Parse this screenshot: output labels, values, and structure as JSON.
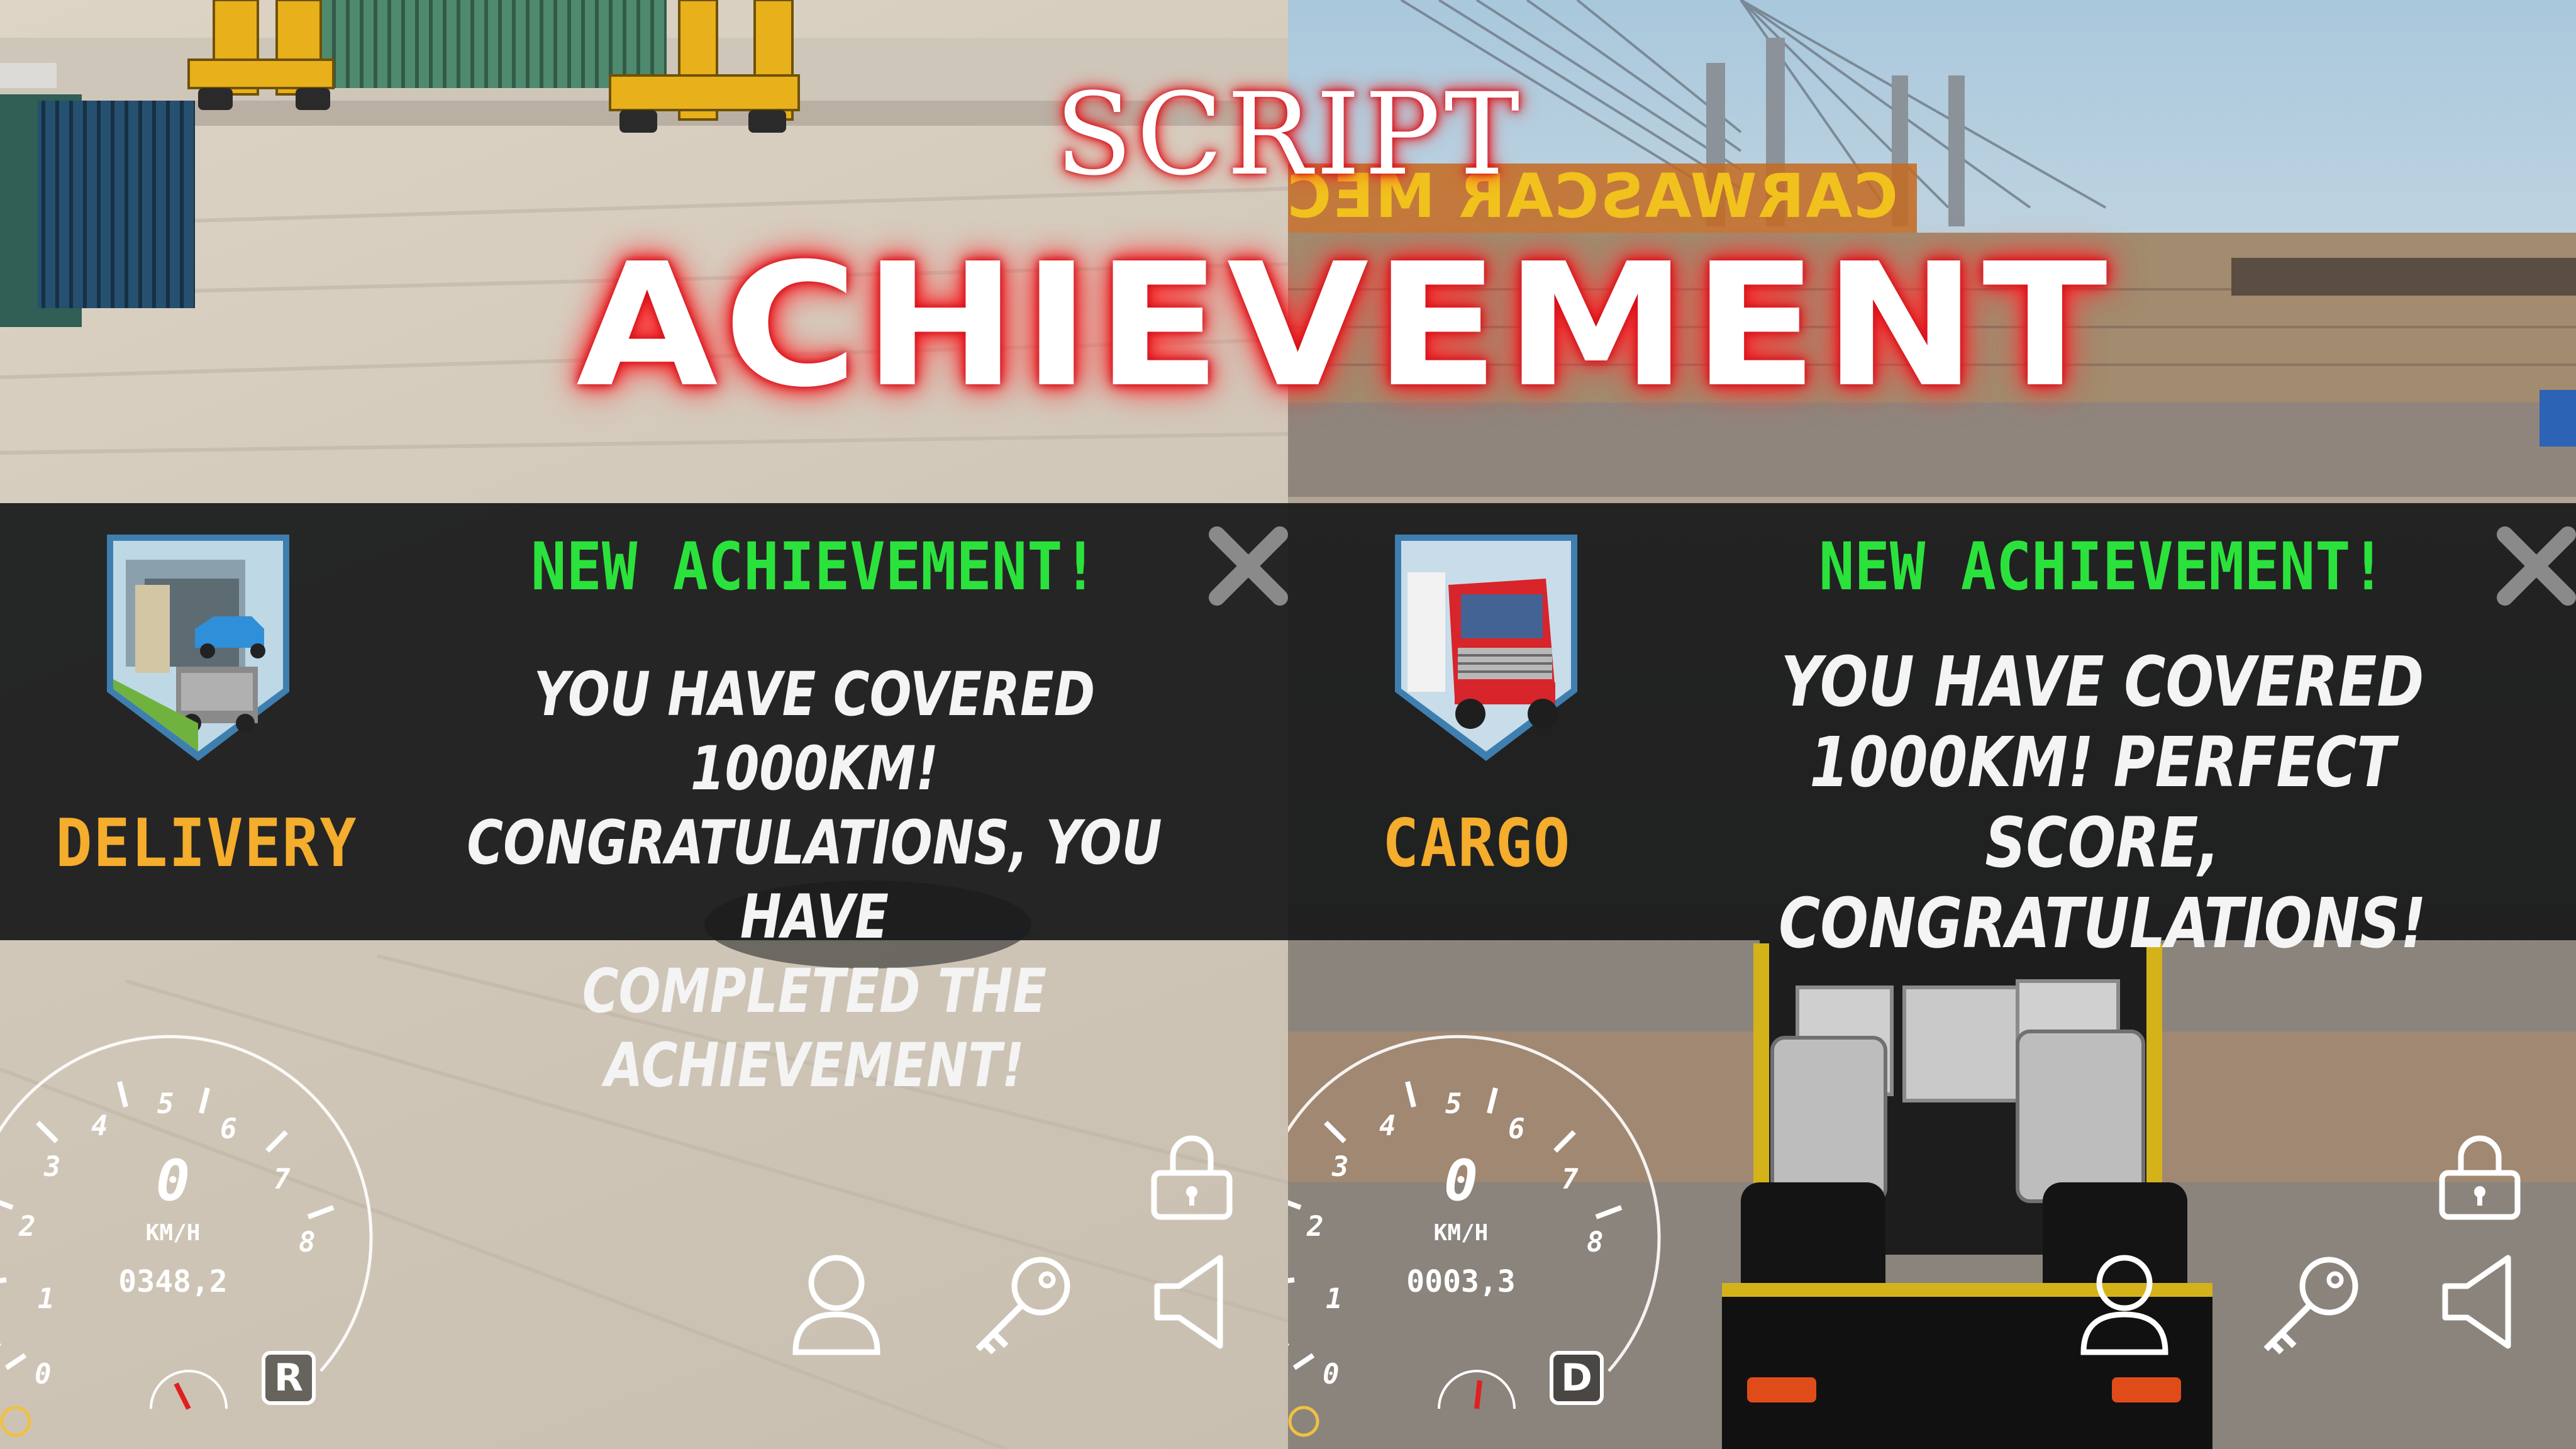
{
  "headline": {
    "line1": "SCRIPT",
    "line2": "ACHIEVEMENT"
  },
  "left": {
    "sign_text": "",
    "achievement": {
      "title": "NEW ACHIEVEMENT!",
      "badge_label": "DELIVERY",
      "badge_icon": "delivery-truck-icon",
      "message_lines": [
        "YOU HAVE COVERED 1000KM!",
        "CONGRATULATIONS, YOU HAVE",
        "COMPLETED THE ACHIEVEMENT!"
      ]
    },
    "hud": {
      "speed": "0",
      "speed_unit": "KM/H",
      "odometer": "0348,2",
      "gear": "R",
      "gauge_ticks": [
        "0",
        "1",
        "2",
        "3",
        "4",
        "5",
        "6",
        "7",
        "8"
      ]
    }
  },
  "right": {
    "sign_text": "CARWASCAR MECHA",
    "achievement": {
      "title": "NEW ACHIEVEMENT!",
      "badge_label": "CARGO",
      "badge_icon": "cargo-truck-icon",
      "message_lines": [
        "YOU HAVE COVERED",
        "1000KM! PERFECT SCORE,",
        "CONGRATULATIONS!"
      ]
    },
    "hud": {
      "speed": "0",
      "speed_unit": "KM/H",
      "odometer": "0003,3",
      "gear": "D",
      "gauge_ticks": [
        "0",
        "1",
        "2",
        "3",
        "4",
        "5",
        "6",
        "7",
        "8"
      ]
    }
  },
  "colors": {
    "achievement_title": "#2be23c",
    "badge_label": "#f4ad2c",
    "banner_bg": "#18191a",
    "headline_glow": "#d40f19"
  }
}
